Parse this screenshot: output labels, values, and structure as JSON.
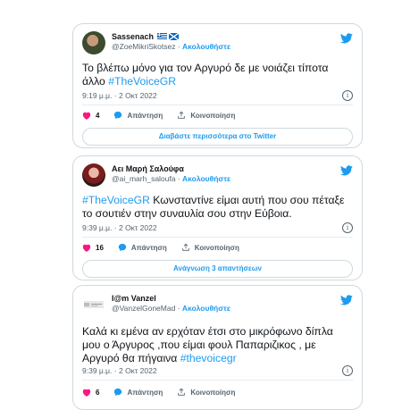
{
  "tweets": [
    {
      "name": "Sassenach",
      "handle": "@ZoeMikriSkotsez",
      "follow": "Ακολουθήστε",
      "text_plain": "Το βλέπω μόνο για τον Αργυρό δε με νοιάζει τίποτα άλλο ",
      "hashtag": "#TheVoiceGR",
      "time": "9:19 μ.μ. · 2 Οκτ 2022",
      "likes": "4",
      "reply": "Απάντηση",
      "share": "Κοινοποίηση",
      "more": "Διαβάστε περισσότερα στο Twitter"
    },
    {
      "name": "Αει Μαρή Σαλούφα",
      "handle": "@ai_marh_saloufa",
      "follow": "Ακολουθήστε",
      "hashtag": "#TheVoiceGR",
      "text_plain": " Κωνσταντίνε είμαι αυτή που σου πέταξε το σουτιέν στην συναυλία σου στην Εύβοια.",
      "time": "9:39 μ.μ. · 2 Οκτ 2022",
      "likes": "16",
      "reply": "Απάντηση",
      "share": "Κοινοποίηση",
      "more": "Ανάγνωση 3 απαντήσεων"
    },
    {
      "name": "I@m Vanzel",
      "handle": "@VanzelGoneMad",
      "follow": "Ακολουθήστε",
      "text_plain": "Καλά κι εμένα αν ερχόταν έτσι στο μικρόφωνο δίπλα μου ο Άργυρος ,που είμαι φουλ Παπαριζικος , με Αργυρό θα πήγαινα ",
      "hashtag": "#thevoicegr",
      "time": "9:39 μ.μ. · 2 Οκτ 2022",
      "likes": "6",
      "reply": "Απάντηση",
      "share": "Κοινοποίηση"
    }
  ],
  "colors": {
    "accent": "#1d9bf0",
    "like": "#f91880",
    "border": "#cfd9de"
  },
  "icons": {
    "brand": "twitter-bird-icon",
    "like": "heart-icon",
    "reply": "reply-bubble-icon",
    "share": "share-icon",
    "info": "info-icon"
  }
}
